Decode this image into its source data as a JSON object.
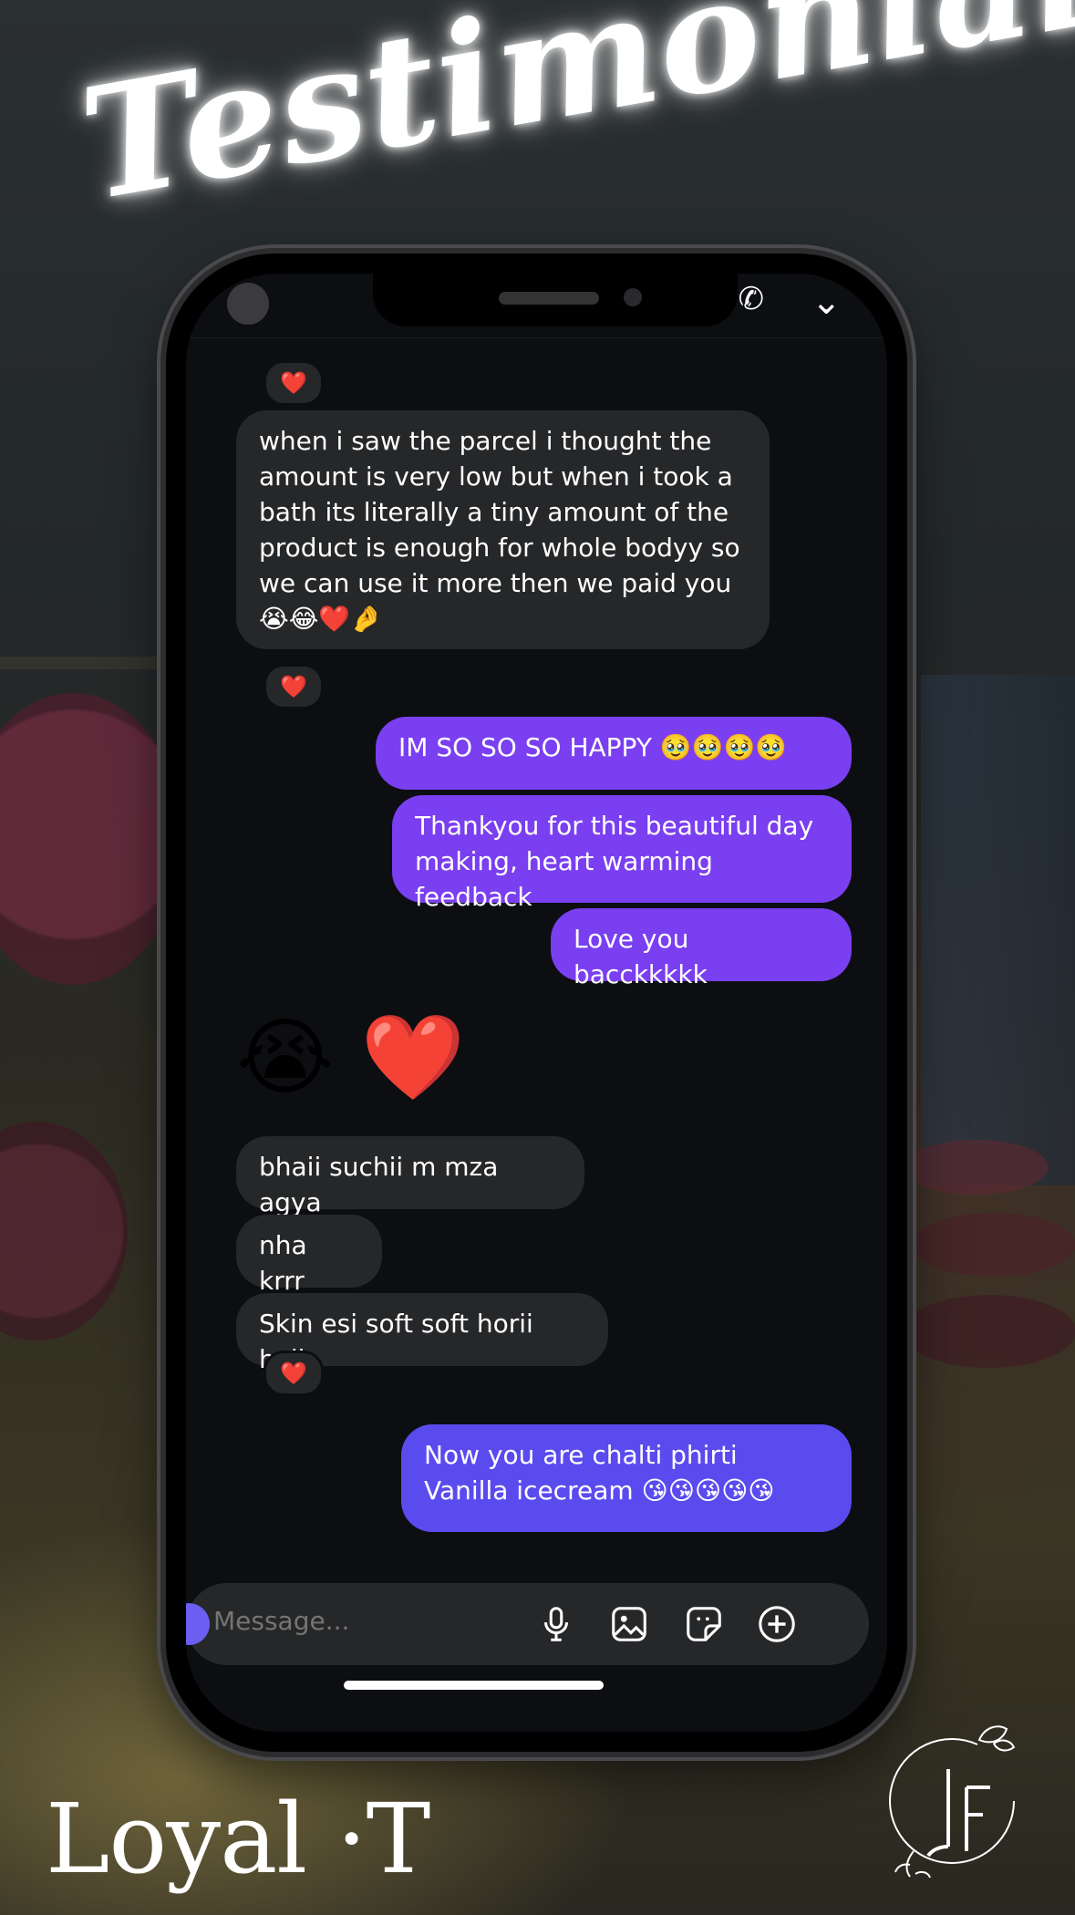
{
  "title": "Testimonial",
  "brand": "Loyal T",
  "brand_separator": "·",
  "chat": {
    "top_react": "❤️",
    "msg1": "when i saw the parcel i thought the amount is very low but when i took a bath its literally a tiny amount of the product is enough for whole bodyy so we can use it more then we paid you 😭😂❤️🤌",
    "msg1_react": "❤️",
    "reply1": "IM SO SO SO HAPPY 🥹🥹🥹🥹",
    "reply2": "Thankyou for this beautiful day making, heart warming feedback",
    "reply3": "Love you bacckkkkk",
    "emoji_msg": "😭 ❤️",
    "msg2": "bhaii suchii m mza agya",
    "msg3": "nha krrr",
    "msg4": "Skin esi soft soft horii haii",
    "msg4_react": "❤️",
    "reply4": "Now you are chalti phirti Vanilla icecream 😘😘😘😘😘"
  },
  "composer": {
    "placeholder": "Message..."
  },
  "icons": [
    "chevron-down-icon",
    "call-icon",
    "mic-icon",
    "gallery-icon",
    "sticker-icon",
    "plus-icon"
  ],
  "colors": {
    "outgoing": "#7a3ff0",
    "outgoing_alt": "#5a4bef",
    "incoming": "#262729",
    "screen": "#0d0e12"
  }
}
